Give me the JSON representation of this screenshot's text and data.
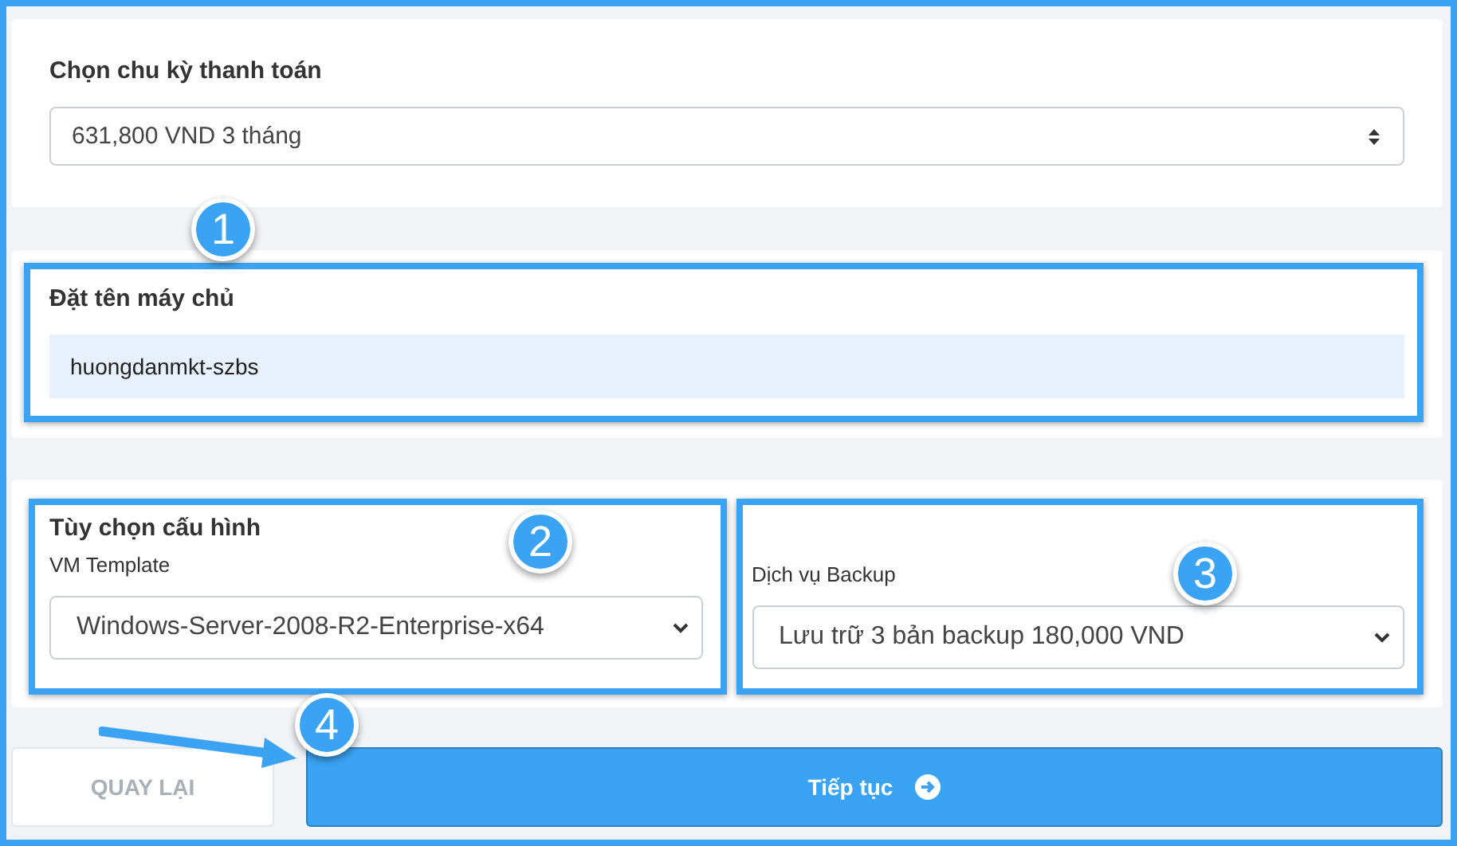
{
  "billing": {
    "label": "Chọn chu kỳ thanh toán",
    "value": "631,800 VND 3 tháng"
  },
  "server_name": {
    "label": "Đặt tên máy chủ",
    "value": "huongdanmkt-szbs"
  },
  "config": {
    "title": "Tùy chọn cấu hình",
    "template_label": "VM Template",
    "template_value": "Windows-Server-2008-R2-Enterprise-x64",
    "backup_label": "Dịch vụ Backup",
    "backup_value": "Lưu trữ 3 bản backup 180,000 VND"
  },
  "buttons": {
    "back": "QUAY LẠI",
    "next": "Tiếp tục"
  },
  "callouts": [
    "1",
    "2",
    "3",
    "4"
  ]
}
